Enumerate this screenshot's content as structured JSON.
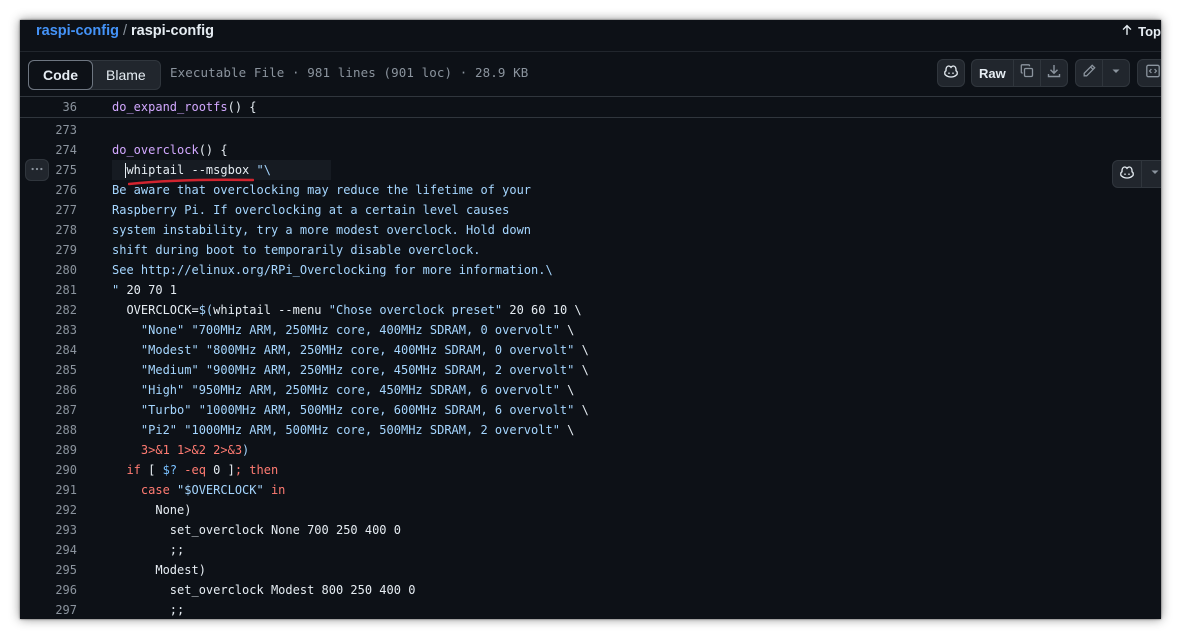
{
  "breadcrumb": {
    "repo": "raspi-config",
    "separator": "/",
    "file": "raspi-config"
  },
  "top_link": "Top",
  "tabs": [
    {
      "label": "Code",
      "active": true
    },
    {
      "label": "Blame",
      "active": false
    }
  ],
  "file_info": "Executable File · 981 lines (901 loc) · 28.9 KB",
  "toolbar": {
    "raw_label": "Raw"
  },
  "icons": [
    "arrow-up-icon",
    "copilot-icon",
    "copy-icon",
    "download-icon",
    "pencil-icon",
    "chevron-down-icon",
    "code-symbols-icon",
    "kebab-horizontal-icon"
  ],
  "colors": {
    "background": "#0d1117",
    "link": "#4493f8",
    "function": "#d2a8ff",
    "string": "#a5d6ff",
    "keyword": "#ff7b72",
    "constant": "#79c0ff",
    "annotation_underline": "#d1242f"
  },
  "sticky": {
    "line": "36",
    "tokens": [
      [
        "fn",
        "do_expand_rootfs"
      ],
      [
        "pl",
        "() {"
      ]
    ]
  },
  "lines": [
    {
      "n": "273",
      "tokens": []
    },
    {
      "n": "274",
      "tokens": [
        [
          "fn",
          "do_overclock"
        ],
        [
          "pl",
          "() {"
        ]
      ]
    },
    {
      "n": "275",
      "tokens": [
        [
          "pl",
          "  whiptail --msgbox "
        ],
        [
          "str",
          "\"\\"
        ]
      ]
    },
    {
      "n": "276",
      "tokens": [
        [
          "str",
          "Be aware that overclocking may reduce the lifetime of your"
        ]
      ]
    },
    {
      "n": "277",
      "tokens": [
        [
          "str",
          "Raspberry Pi. If overclocking at a certain level causes"
        ]
      ]
    },
    {
      "n": "278",
      "tokens": [
        [
          "str",
          "system instability, try a more modest overclock. Hold down"
        ]
      ]
    },
    {
      "n": "279",
      "tokens": [
        [
          "str",
          "shift during boot to temporarily disable overclock."
        ]
      ]
    },
    {
      "n": "280",
      "tokens": [
        [
          "str",
          "See http://elinux.org/RPi_Overclocking for more information.\\"
        ]
      ]
    },
    {
      "n": "281",
      "tokens": [
        [
          "str",
          "\""
        ],
        [
          "pl",
          " 20 70 1"
        ]
      ]
    },
    {
      "n": "282",
      "tokens": [
        [
          "pl",
          "  OVERCLOCK="
        ],
        [
          "str",
          "$("
        ],
        [
          "pl",
          "whiptail --menu "
        ],
        [
          "str",
          "\"Chose overclock preset\""
        ],
        [
          "pl",
          " 20 60 10 \\"
        ]
      ]
    },
    {
      "n": "283",
      "tokens": [
        [
          "str",
          "    \"None\" \"700MHz ARM, 250MHz core, 400MHz SDRAM, 0 overvolt\""
        ],
        [
          "pl",
          " \\"
        ]
      ]
    },
    {
      "n": "284",
      "tokens": [
        [
          "str",
          "    \"Modest\" \"800MHz ARM, 250MHz core, 400MHz SDRAM, 0 overvolt\""
        ],
        [
          "pl",
          " \\"
        ]
      ]
    },
    {
      "n": "285",
      "tokens": [
        [
          "str",
          "    \"Medium\" \"900MHz ARM, 250MHz core, 450MHz SDRAM, 2 overvolt\""
        ],
        [
          "pl",
          " \\"
        ]
      ]
    },
    {
      "n": "286",
      "tokens": [
        [
          "str",
          "    \"High\" \"950MHz ARM, 250MHz core, 450MHz SDRAM, 6 overvolt\""
        ],
        [
          "pl",
          " \\"
        ]
      ]
    },
    {
      "n": "287",
      "tokens": [
        [
          "str",
          "    \"Turbo\" \"1000MHz ARM, 500MHz core, 600MHz SDRAM, 6 overvolt\""
        ],
        [
          "pl",
          " \\"
        ]
      ]
    },
    {
      "n": "288",
      "tokens": [
        [
          "str",
          "    \"Pi2\" \"1000MHz ARM, 500MHz core, 500MHz SDRAM, 2 overvolt\""
        ],
        [
          "pl",
          " \\"
        ]
      ]
    },
    {
      "n": "289",
      "tokens": [
        [
          "kw",
          "    3>&1 1>&2 2>&3"
        ],
        [
          "str",
          ")"
        ]
      ]
    },
    {
      "n": "290",
      "tokens": [
        [
          "kw",
          "  if"
        ],
        [
          "pl",
          " [ "
        ],
        [
          "con",
          "$?"
        ],
        [
          "kw",
          " -eq"
        ],
        [
          "pl",
          " 0 ]"
        ],
        [
          "kw",
          "; then"
        ]
      ]
    },
    {
      "n": "291",
      "tokens": [
        [
          "kw",
          "    case"
        ],
        [
          "pl",
          " "
        ],
        [
          "str",
          "\"$OVERCLOCK\""
        ],
        [
          "kw",
          " in"
        ]
      ]
    },
    {
      "n": "292",
      "tokens": [
        [
          "pl",
          "      None)"
        ]
      ]
    },
    {
      "n": "293",
      "tokens": [
        [
          "pl",
          "        set_overclock None 700 250 400 0"
        ]
      ]
    },
    {
      "n": "294",
      "tokens": [
        [
          "pl",
          "        ;;"
        ]
      ]
    },
    {
      "n": "295",
      "tokens": [
        [
          "pl",
          "      Modest)"
        ]
      ]
    },
    {
      "n": "296",
      "tokens": [
        [
          "pl",
          "        set_overclock Modest 800 250 400 0"
        ]
      ]
    },
    {
      "n": "297",
      "tokens": [
        [
          "pl",
          "        ;;"
        ]
      ]
    }
  ]
}
